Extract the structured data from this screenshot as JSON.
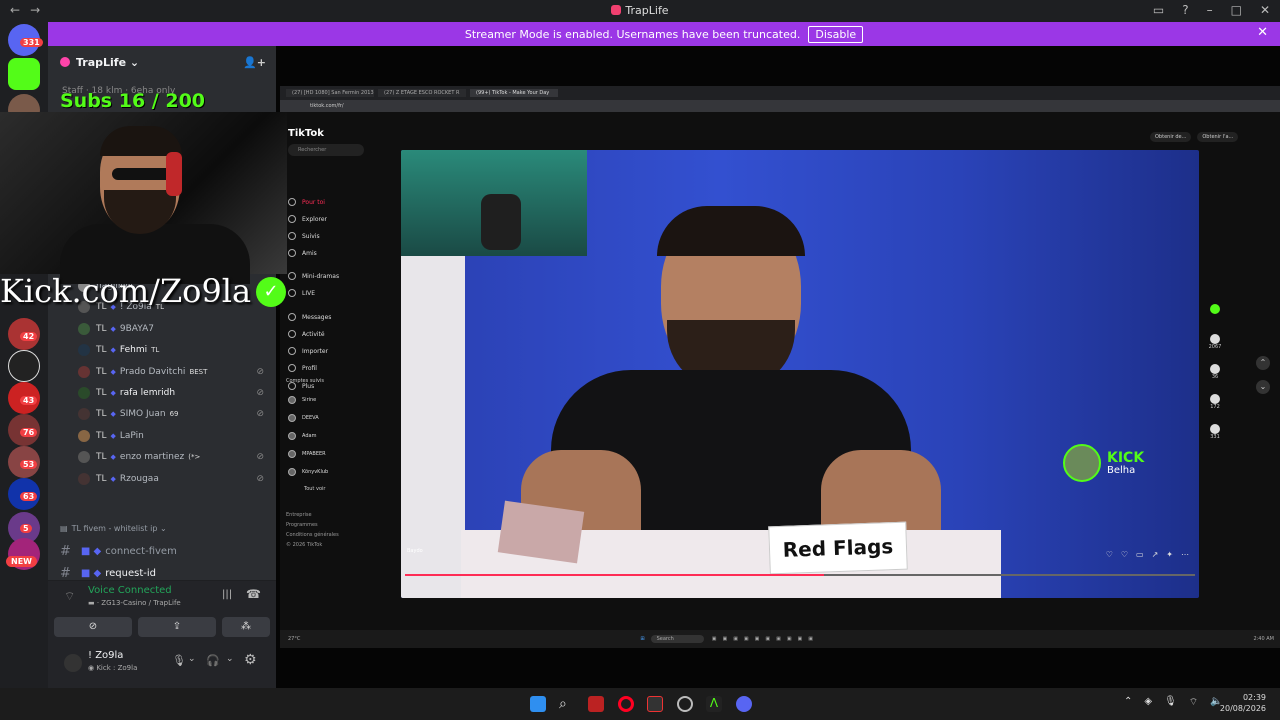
{
  "window": {
    "title": "TrapLife",
    "nav_back": "←",
    "nav_fwd": "→"
  },
  "banner": {
    "text": "Streamer Mode is enabled. Usernames have been truncated.",
    "disable_label": "Disable"
  },
  "guilds": {
    "top_badge": "331",
    "badges": [
      "42",
      "43",
      "76",
      "53",
      "63",
      "5"
    ],
    "new_label": "NEW"
  },
  "server": {
    "name": "TrapLife",
    "staff_text": "Staff · 18 klm · 6eha only"
  },
  "overlay": {
    "subs": "Subs 16 / 200",
    "kick_url": "Kick.com/Zo9la"
  },
  "members": [
    {
      "prefix": "",
      "name": "nagiiiiiiii",
      "tag": ""
    },
    {
      "prefix": "TL",
      "name": "! Zo9la",
      "tag": "TL"
    },
    {
      "prefix": "TL",
      "name": "9BAYA7",
      "tag": ""
    },
    {
      "prefix": "TL",
      "name": "Fehmi",
      "tag": "TL"
    },
    {
      "prefix": "TL",
      "name": "Prado Davitchi",
      "tag": "BEST"
    },
    {
      "prefix": "TL",
      "name": "rafa lemridh",
      "tag": ""
    },
    {
      "prefix": "TL",
      "name": "SIMO Juan",
      "tag": "69"
    },
    {
      "prefix": "TL",
      "name": "LaPin",
      "tag": ""
    },
    {
      "prefix": "TL",
      "name": "enzo martinez",
      "tag": "(*>"
    },
    {
      "prefix": "TL",
      "name": "Rzougaa",
      "tag": ""
    }
  ],
  "channels": {
    "category": "TL fivem - whitelist ip",
    "items": [
      "connect-fivem",
      "request-id"
    ]
  },
  "voice": {
    "status": "Voice Connected",
    "location": "ZG13-Casino / TrapLife"
  },
  "user": {
    "name": "! Zo9la",
    "status": "Kick : Zo9la"
  },
  "browser": {
    "tabs": [
      "(27) [HD 1080] San Fermin 2013",
      "(27) Z ETAGE ESCO ROCKET R",
      "(99+) TikTok - Make Your Day"
    ],
    "url": "tiktok.com/fr/"
  },
  "tiktok": {
    "logo": "TikTok",
    "search_placeholder": "Rechercher",
    "nav": [
      "Pour toi",
      "Explorer",
      "Suivis",
      "Amis",
      "Mini-dramas",
      "LIVE",
      "Messages",
      "Activité",
      "Importer",
      "Profil",
      "Plus"
    ],
    "following_title": "Comptes suivis",
    "following": [
      "Sirine",
      "DEEVA",
      "Adam",
      "MPABEER",
      "KönyvKlub"
    ],
    "see_all": "Tout voir",
    "footer": [
      "Entreprise",
      "Programmes",
      "Conditions générales",
      "© 2026 TikTok"
    ],
    "top_buttons": [
      "Obtenir de...",
      "Obtenir l'a..."
    ],
    "video_caption": "Baydo",
    "video_sign": "Red Flags",
    "kick_badge": {
      "label": "KICK",
      "name": "Belha"
    },
    "progress": 0.53,
    "rail": [
      "2067",
      "36",
      "172",
      "331"
    ]
  },
  "inner_taskbar": {
    "weather": "27°C",
    "search": "Search",
    "time": "2:40 AM"
  },
  "taskbar": {
    "time": "02:39",
    "date": "20/08/2026"
  },
  "colors": {
    "banner": "#9b37e6",
    "kick_green": "#53fc18",
    "tiktok_red": "#fe2c55"
  }
}
